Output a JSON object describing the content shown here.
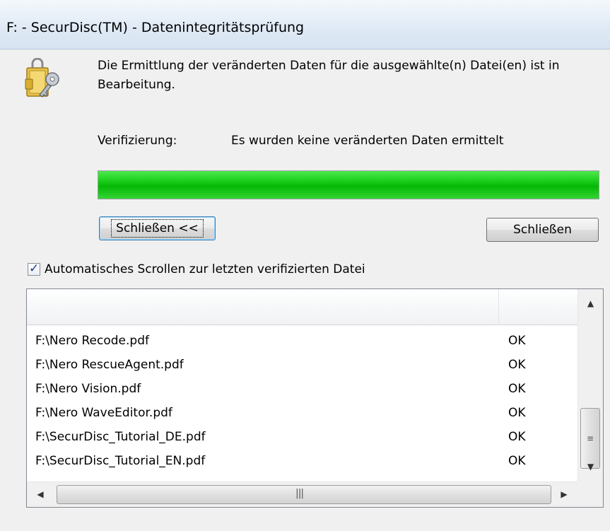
{
  "window": {
    "title": "F: - SecurDisc(TM) - Datenintegritätsprüfung"
  },
  "message": "Die Ermittlung der veränderten Daten für die ausgewählte(n) Datei(en) ist in Bearbeitung.",
  "verification": {
    "label": "Verifizierung:",
    "value": "Es wurden keine veränderten Daten ermittelt"
  },
  "progress": {
    "percent": 100,
    "color": "#10c410"
  },
  "buttons": {
    "details_label": "Schließen <<",
    "close_label": "Schließen"
  },
  "auto_scroll": {
    "checked": true,
    "label": "Automatisches Scrollen zur letzten verifizierten Datei"
  },
  "icons": {
    "app": "key-lock-icon",
    "scroll_up": "arrow-up-icon",
    "scroll_down": "arrow-down-icon",
    "scroll_left": "arrow-left-icon",
    "scroll_right": "arrow-right-icon"
  },
  "file_list": {
    "rows": [
      {
        "name": "F:\\Nero Recode.pdf",
        "status": "OK"
      },
      {
        "name": "F:\\Nero RescueAgent.pdf",
        "status": "OK"
      },
      {
        "name": "F:\\Nero Vision.pdf",
        "status": "OK"
      },
      {
        "name": "F:\\Nero WaveEditor.pdf",
        "status": "OK"
      },
      {
        "name": "F:\\SecurDisc_Tutorial_DE.pdf",
        "status": "OK"
      },
      {
        "name": "F:\\SecurDisc_Tutorial_EN.pdf",
        "status": "OK"
      }
    ]
  }
}
